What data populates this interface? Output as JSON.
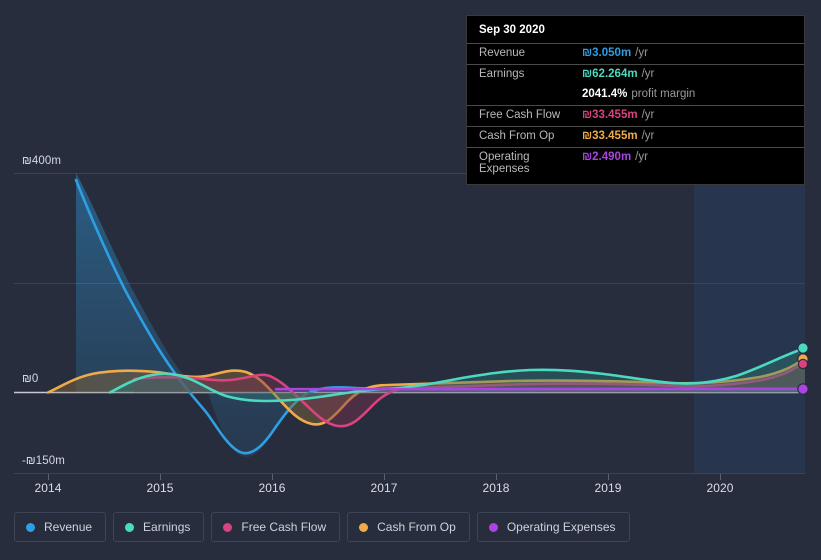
{
  "tooltip": {
    "date": "Sep 30 2020",
    "rows": [
      {
        "key": "Revenue",
        "value": "₪3.050m",
        "unit": "/yr",
        "color": "#2e9fe3"
      },
      {
        "key": "Earnings",
        "value": "₪62.264m",
        "unit": "/yr",
        "color": "#4bd9c0"
      },
      {
        "key": "",
        "value": "2041.4%",
        "unit": "profit margin",
        "color": "#ffffff"
      },
      {
        "key": "Free Cash Flow",
        "value": "₪33.455m",
        "unit": "/yr",
        "color": "#d9437f"
      },
      {
        "key": "Cash From Op",
        "value": "₪33.455m",
        "unit": "/yr",
        "color": "#efab4a"
      },
      {
        "key": "Operating Expenses",
        "value": "₪2.490m",
        "unit": "/yr",
        "color": "#ab44e0"
      }
    ]
  },
  "legend": {
    "items": [
      {
        "label": "Revenue",
        "color": "#2e9fe3"
      },
      {
        "label": "Earnings",
        "color": "#4bd9c0"
      },
      {
        "label": "Free Cash Flow",
        "color": "#d9437f"
      },
      {
        "label": "Cash From Op",
        "color": "#efab4a"
      },
      {
        "label": "Operating Expenses",
        "color": "#ab44e0"
      }
    ]
  },
  "chart_data": {
    "type": "area",
    "title": "",
    "xlabel": "",
    "ylabel": "",
    "currency": "₪",
    "grid": true,
    "legend_position": "bottom",
    "ylim": [
      -150,
      400
    ],
    "y_ticks": [
      {
        "value": 400,
        "label": "₪400m"
      },
      {
        "value": 0,
        "label": "₪0"
      },
      {
        "value": -150,
        "label": "-₪150m"
      }
    ],
    "x_ticks": [
      "2014",
      "2015",
      "2016",
      "2017",
      "2018",
      "2019",
      "2020"
    ],
    "xlim": [
      "2013-09",
      "2020-12"
    ],
    "highlight_band": {
      "from": "2019-10",
      "to": "2020-12"
    },
    "series": [
      {
        "name": "Revenue",
        "color": "#2e9fe3",
        "x": [
          2013.95,
          2014.1,
          2014.3,
          2014.55,
          2014.8,
          2015.0,
          2015.2,
          2015.4,
          2015.55,
          2015.75,
          2016.0,
          2016.3,
          2016.6,
          2017.0,
          2017.5,
          2018.0,
          2018.5,
          2019.0,
          2019.5,
          2020.0,
          2020.75
        ],
        "values": [
          400,
          330,
          250,
          170,
          95,
          30,
          -55,
          -120,
          -148,
          -120,
          -40,
          -2,
          1.5,
          2.0,
          2.2,
          2.4,
          2.5,
          2.6,
          2.8,
          2.9,
          3.05
        ]
      },
      {
        "name": "Earnings",
        "color": "#4bd9c0",
        "x": [
          2013.95,
          2014.2,
          2014.5,
          2014.8,
          2015.1,
          2015.4,
          2015.7,
          2016.0,
          2016.35,
          2016.7,
          2017.0,
          2017.4,
          2017.8,
          2018.2,
          2018.6,
          2019.0,
          2019.4,
          2019.8,
          2020.2,
          2020.55,
          2020.75
        ],
        "values": [
          0,
          22,
          36,
          34,
          22,
          10,
          2,
          -6,
          -8,
          -4,
          2,
          8,
          18,
          26,
          30,
          28,
          22,
          16,
          20,
          42,
          62.26
        ]
      },
      {
        "name": "Free Cash Flow",
        "color": "#d9437f",
        "x": [
          2014.6,
          2014.9,
          2015.2,
          2015.5,
          2015.8,
          2016.0,
          2016.3,
          2016.6,
          2017.0,
          2017.5,
          2018.0,
          2018.5,
          2019.0,
          2019.5,
          2020.0,
          2020.4,
          2020.75
        ],
        "values": [
          22,
          24,
          20,
          24,
          12,
          2,
          -8,
          -16,
          -2,
          5,
          8,
          10,
          9,
          7,
          8,
          18,
          33.46
        ]
      },
      {
        "name": "Cash From Op",
        "color": "#efab4a",
        "x": [
          2013.95,
          2014.25,
          2014.6,
          2014.9,
          2015.2,
          2015.5,
          2015.8,
          2016.0,
          2016.3,
          2016.6,
          2017.0,
          2017.5,
          2018.0,
          2018.5,
          2019.0,
          2019.5,
          2020.0,
          2020.4,
          2020.75
        ],
        "values": [
          0,
          28,
          30,
          27,
          22,
          27,
          13,
          3,
          -10,
          -19,
          -2,
          6,
          9,
          11,
          10,
          8,
          9,
          19,
          33.46
        ]
      },
      {
        "name": "Operating Expenses",
        "color": "#ab44e0",
        "x": [
          2016.0,
          2016.5,
          2017.0,
          2017.5,
          2018.0,
          2018.5,
          2019.0,
          2019.5,
          2020.0,
          2020.75
        ],
        "values": [
          2.4,
          2.4,
          2.45,
          2.45,
          2.45,
          2.48,
          2.48,
          2.49,
          2.49,
          2.49
        ]
      }
    ]
  }
}
